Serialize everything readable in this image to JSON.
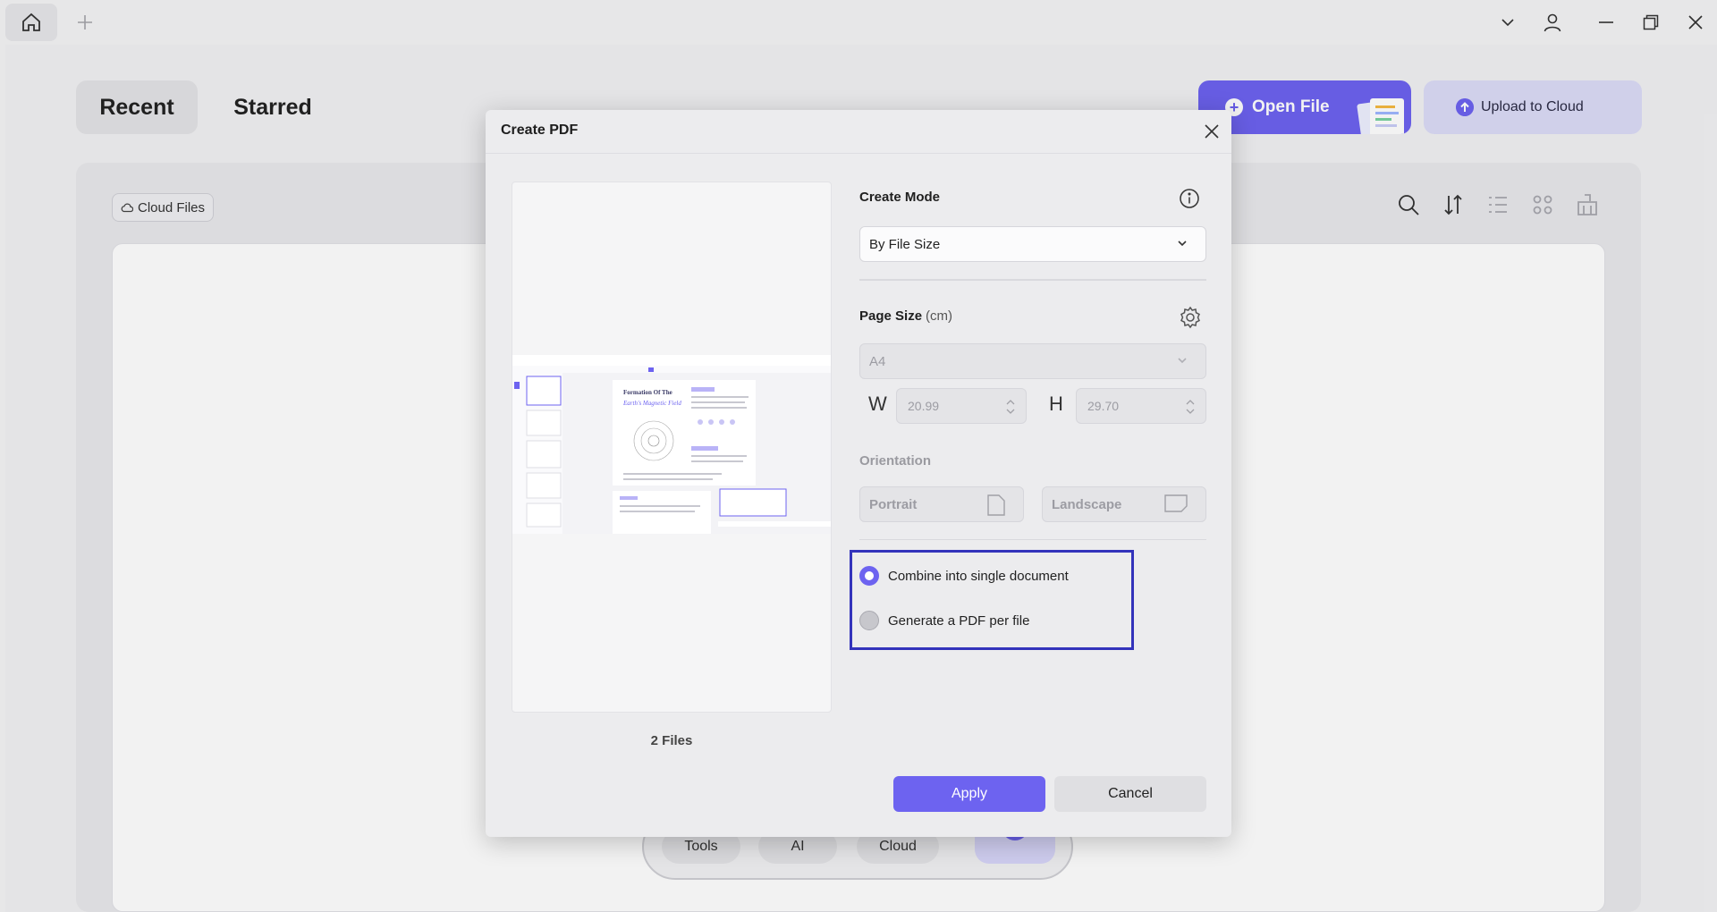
{
  "titlebar": {
    "icons": [
      "home-icon",
      "plus-icon",
      "chevron-down-icon",
      "user-icon",
      "minimize-icon",
      "restore-icon",
      "close-icon"
    ]
  },
  "home": {
    "tabs": [
      "Recent",
      "Starred"
    ],
    "open_file_label": "Open File",
    "upload_label": "Upload to Cloud",
    "cloud_files_label": "Cloud Files",
    "toolbar_icons": [
      "search-icon",
      "sort-icon",
      "list-view-icon",
      "grid-view-icon",
      "clean-icon"
    ],
    "dock": [
      "Tools",
      "AI",
      "Cloud"
    ]
  },
  "dialog": {
    "title": "Create PDF",
    "files_count": "2 Files",
    "create_mode_label": "Create Mode",
    "create_mode_value": "By File Size",
    "page_size_label": "Page Size",
    "page_size_unit": "(cm)",
    "page_size_value": "A4",
    "w_label": "W",
    "w_value": "20.99",
    "h_label": "H",
    "h_value": "29.70",
    "orientation_label": "Orientation",
    "portrait_label": "Portrait",
    "landscape_label": "Landscape",
    "options": [
      {
        "label": "Combine into single document",
        "selected": true
      },
      {
        "label": "Generate a PDF per file",
        "selected": false
      }
    ],
    "apply_label": "Apply",
    "cancel_label": "Cancel",
    "preview_doc_title": "Formation Of The",
    "preview_doc_subtitle": "Earth's Magnetic Field"
  },
  "colors": {
    "accent": "#6d63f0",
    "highlight_border": "#3333bb"
  }
}
